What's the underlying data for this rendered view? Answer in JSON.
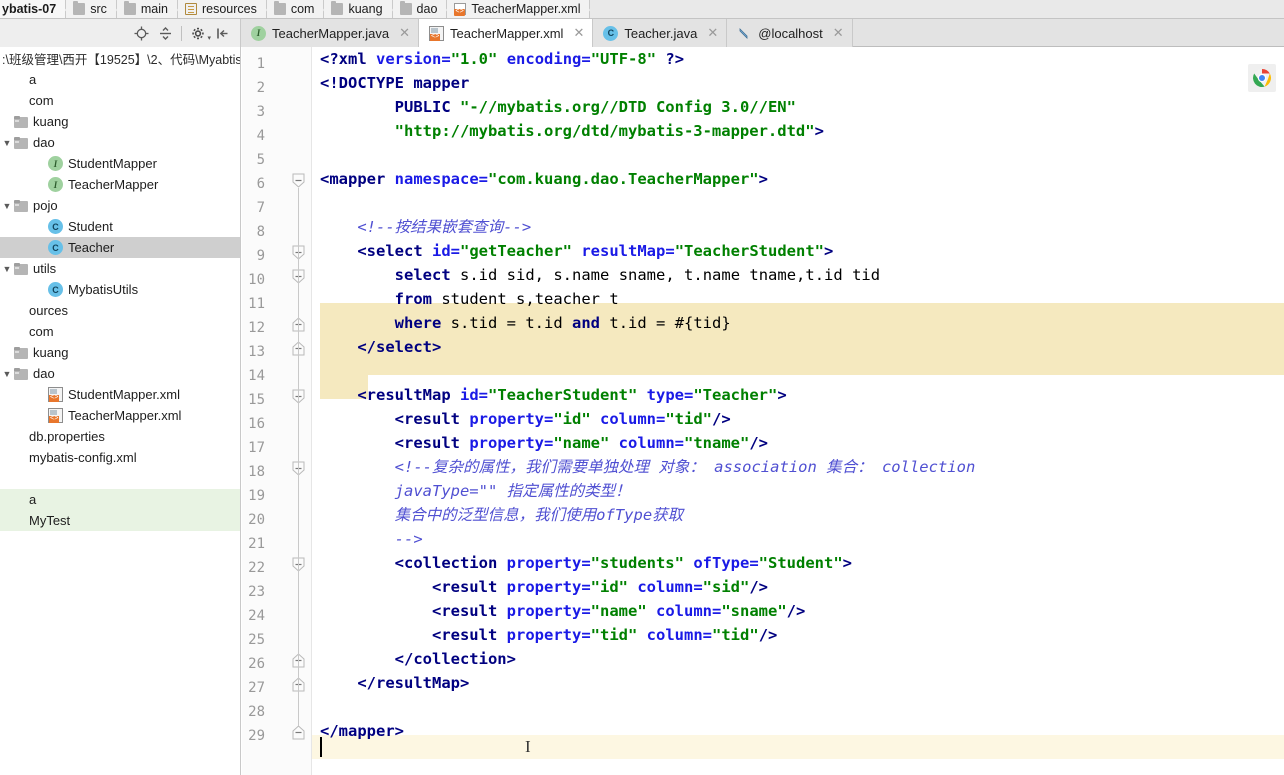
{
  "breadcrumb": {
    "items": [
      {
        "label": "ybatis-07",
        "icon": "none"
      },
      {
        "label": "src",
        "icon": "folder-grey-icon"
      },
      {
        "label": "main",
        "icon": "folder-grey-icon"
      },
      {
        "label": "resources",
        "icon": "resources-folder-icon"
      },
      {
        "label": "com",
        "icon": "folder-grey-icon"
      },
      {
        "label": "kuang",
        "icon": "folder-grey-icon"
      },
      {
        "label": "dao",
        "icon": "folder-grey-icon"
      },
      {
        "label": "TeacherMapper.xml",
        "icon": "xml-file-icon"
      }
    ]
  },
  "project_toolbar": {
    "buttons": [
      {
        "name": "locate-in-tree-icon",
        "glyph": "⊕"
      },
      {
        "name": "collapse-all-icon",
        "glyph": "÷"
      },
      {
        "name": "settings-gear-icon",
        "glyph": "⚙"
      },
      {
        "name": "hide-panel-icon",
        "glyph": "⇥"
      }
    ]
  },
  "tabs": [
    {
      "label": "TeacherMapper.java",
      "icon": "interface-icon",
      "active": false,
      "closable": true
    },
    {
      "label": "TeacherMapper.xml",
      "icon": "mapper-xml-icon",
      "active": true,
      "closable": true
    },
    {
      "label": "Teacher.java",
      "icon": "class-icon",
      "active": false,
      "closable": true
    },
    {
      "label": "@localhost",
      "icon": "database-icon",
      "active": false,
      "closable": true
    }
  ],
  "sidebar": {
    "path_line": ":\\班级管理\\西开【19525】\\2、代码\\Myabtis",
    "tree": [
      {
        "indent": 0,
        "label": "a",
        "icon": "none",
        "arrow": "",
        "state": "normal"
      },
      {
        "indent": 0,
        "label": "com",
        "icon": "none",
        "arrow": "",
        "state": "normal"
      },
      {
        "indent": 1,
        "label": "kuang",
        "icon": "folder-icon",
        "arrow": "",
        "state": "normal"
      },
      {
        "indent": 1,
        "label": "dao",
        "icon": "folder-icon",
        "arrow": "expanded",
        "state": "normal"
      },
      {
        "indent": 3,
        "label": "StudentMapper",
        "icon": "interface-icon",
        "arrow": "",
        "state": "normal"
      },
      {
        "indent": 3,
        "label": "TeacherMapper",
        "icon": "interface-icon",
        "arrow": "",
        "state": "normal"
      },
      {
        "indent": 1,
        "label": "pojo",
        "icon": "folder-icon",
        "arrow": "expanded",
        "state": "normal"
      },
      {
        "indent": 3,
        "label": "Student",
        "icon": "class-icon",
        "arrow": "",
        "state": "normal"
      },
      {
        "indent": 3,
        "label": "Teacher",
        "icon": "class-icon",
        "arrow": "",
        "state": "selected"
      },
      {
        "indent": 1,
        "label": "utils",
        "icon": "folder-icon",
        "arrow": "expanded",
        "state": "normal"
      },
      {
        "indent": 3,
        "label": "MybatisUtils",
        "icon": "class-icon",
        "arrow": "",
        "state": "normal"
      },
      {
        "indent": 0,
        "label": "ources",
        "icon": "none",
        "arrow": "",
        "state": "normal"
      },
      {
        "indent": 0,
        "label": "com",
        "icon": "none",
        "arrow": "",
        "state": "normal"
      },
      {
        "indent": 1,
        "label": "kuang",
        "icon": "folder-icon",
        "arrow": "",
        "state": "normal"
      },
      {
        "indent": 1,
        "label": "dao",
        "icon": "folder-icon",
        "arrow": "expanded",
        "state": "normal"
      },
      {
        "indent": 3,
        "label": "StudentMapper.xml",
        "icon": "mapper-xml-icon",
        "arrow": "",
        "state": "normal"
      },
      {
        "indent": 3,
        "label": "TeacherMapper.xml",
        "icon": "mapper-xml-icon",
        "arrow": "",
        "state": "normal"
      },
      {
        "indent": 0,
        "label": "db.properties",
        "icon": "none",
        "arrow": "",
        "state": "normal"
      },
      {
        "indent": 0,
        "label": "mybatis-config.xml",
        "icon": "none",
        "arrow": "",
        "state": "normal"
      },
      {
        "indent": 0,
        "label": "",
        "icon": "none",
        "arrow": "",
        "state": "normal"
      },
      {
        "indent": 0,
        "label": "a",
        "icon": "none",
        "arrow": "",
        "state": "green"
      },
      {
        "indent": 0,
        "label": "MyTest",
        "icon": "none",
        "arrow": "",
        "state": "green"
      }
    ]
  },
  "editor": {
    "file": "TeacherMapper.xml",
    "caret_line": 28,
    "total_lines": 29,
    "browser_icon": "chrome-icon",
    "lines": [
      {
        "n": 1,
        "text": "<?xml version=\"1.0\" encoding=\"UTF-8\" ?>"
      },
      {
        "n": 2,
        "text": "<!DOCTYPE mapper"
      },
      {
        "n": 3,
        "text": "        PUBLIC \"-//mybatis.org//DTD Config 3.0//EN\""
      },
      {
        "n": 4,
        "text": "        \"http://mybatis.org/dtd/mybatis-3-mapper.dtd\">"
      },
      {
        "n": 5,
        "text": ""
      },
      {
        "n": 6,
        "text": "<mapper namespace=\"com.kuang.dao.TeacherMapper\">"
      },
      {
        "n": 7,
        "text": ""
      },
      {
        "n": 8,
        "text": "    <!--按结果嵌套查询-->"
      },
      {
        "n": 9,
        "text": "    <select id=\"getTeacher\" resultMap=\"TeacherStudent\">"
      },
      {
        "n": 10,
        "text": "        select s.id sid, s.name sname, t.name tname,t.id tid"
      },
      {
        "n": 11,
        "text": "        from student s,teacher t"
      },
      {
        "n": 12,
        "text": "        where s.tid = t.id and t.id = #{tid}"
      },
      {
        "n": 13,
        "text": "    </select>"
      },
      {
        "n": 14,
        "text": ""
      },
      {
        "n": 15,
        "text": "    <resultMap id=\"TeacherStudent\" type=\"Teacher\">"
      },
      {
        "n": 16,
        "text": "        <result property=\"id\" column=\"tid\"/>"
      },
      {
        "n": 17,
        "text": "        <result property=\"name\" column=\"tname\"/>"
      },
      {
        "n": 18,
        "text": "        <!--复杂的属性，我们需要单独处理 对象： association 集合： collection"
      },
      {
        "n": 19,
        "text": "        javaType=\"\" 指定属性的类型！"
      },
      {
        "n": 20,
        "text": "        集合中的泛型信息，我们使用ofType获取"
      },
      {
        "n": 21,
        "text": "        -->"
      },
      {
        "n": 22,
        "text": "        <collection property=\"students\" ofType=\"Student\">"
      },
      {
        "n": 23,
        "text": "            <result property=\"id\" column=\"sid\"/>"
      },
      {
        "n": 24,
        "text": "            <result property=\"name\" column=\"sname\"/>"
      },
      {
        "n": 25,
        "text": "            <result property=\"tid\" column=\"tid\"/>"
      },
      {
        "n": 26,
        "text": "        </collection>"
      },
      {
        "n": 27,
        "text": "    </resultMap>"
      },
      {
        "n": 28,
        "text": ""
      },
      {
        "n": 29,
        "text": "</mapper>"
      }
    ]
  },
  "colors": {
    "tag": "#000080",
    "attribute": "#1a1ae6",
    "value": "#008000",
    "comment": "#5050d2",
    "sql_highlight": "#f5e9bf",
    "caret_line_highlight": "#fdf7e2",
    "selection": "#cfcfcf"
  }
}
